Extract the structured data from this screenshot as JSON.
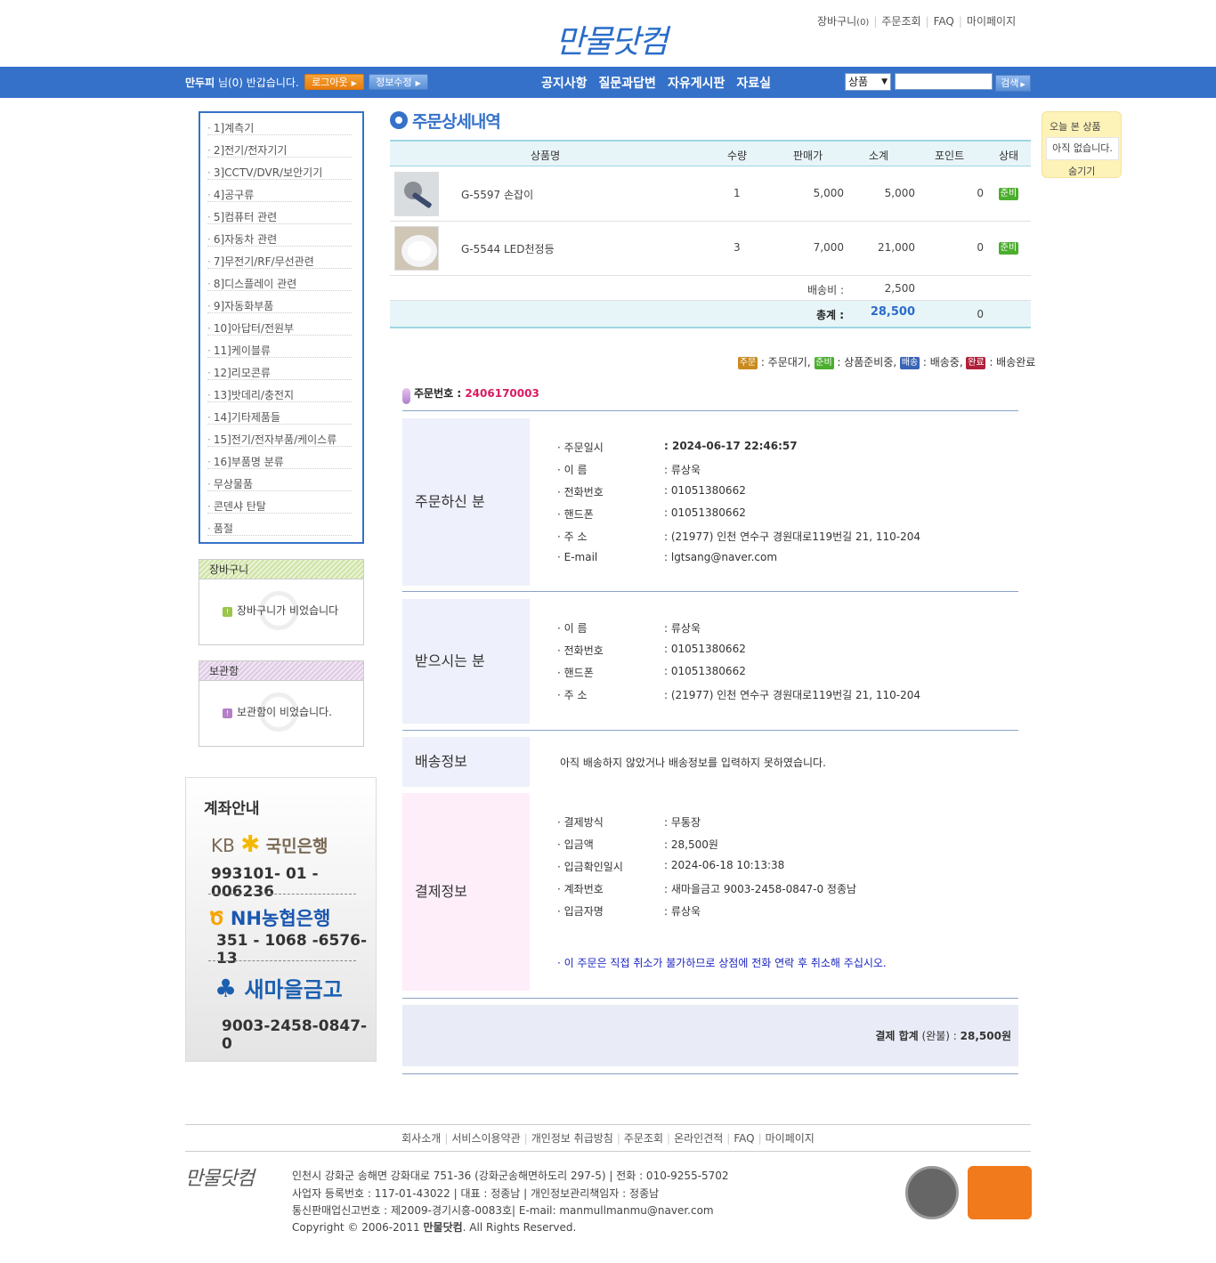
{
  "header": {
    "logo": "만물닷컴",
    "links": [
      "장바구니",
      "주문조회",
      "FAQ",
      "마이페이지"
    ],
    "cart_count": "(0)"
  },
  "navbar": {
    "user": "만두피",
    "greeting": " 님(0) 반갑습니다.",
    "logout": "로그아웃",
    "edit_info": "정보수정",
    "menu": [
      "공지사항",
      "질문과답변",
      "자유게시판",
      "자료실"
    ],
    "search_select": "상품",
    "search_value": "",
    "search_button": "검색"
  },
  "sidebar": {
    "categories": [
      "1]계측기",
      "2]전기/전자기기",
      "3]CCTV/DVR/보안기기",
      "4]공구류",
      "5]컴퓨터 관련",
      "6]자동차 관련",
      "7]무전기/RF/무선관련",
      "8]디스플레이 관련",
      "9]자동화부품",
      "10]아답터/전원부",
      "11]케이블류",
      "12]리모콘류",
      "13]밧데리/충전지",
      "14]기타제품들",
      "15]전기/전자부품/케이스류",
      "16]부품명 분류",
      "무상물품",
      "콘덴샤 탄탈",
      "품절"
    ],
    "cart_title": "장바구니",
    "cart_empty": "장바구니가 비었습니다",
    "keep_title": "보관함",
    "keep_empty": "보관함이 비었습니다.",
    "bank_title": "계좌안내",
    "banks": [
      {
        "name": "KB 국민은행",
        "account": "993101- 01 - 006236",
        "color": "#7a6a55"
      },
      {
        "name": "NH농협은행",
        "account": "351 - 1068 -6576-13",
        "color": "#1b57b0"
      },
      {
        "name": "새마을금고",
        "account": "9003-2458-0847-0",
        "color": "#1b5fb0"
      }
    ]
  },
  "today": {
    "title": "오늘 본 상품",
    "empty": "아직 없습니다.",
    "hide": "숨기기"
  },
  "main": {
    "title": "주문상세내역",
    "columns": [
      "상품명",
      "수량",
      "판매가",
      "소계",
      "포인트",
      "상태"
    ],
    "items": [
      {
        "name": "G-5597 손잡이",
        "qty": "1",
        "price": "5,000",
        "subtotal": "5,000",
        "point": "0",
        "status": "준비"
      },
      {
        "name": "G-5544 LED천정등",
        "qty": "3",
        "price": "7,000",
        "subtotal": "21,000",
        "point": "0",
        "status": "준비"
      }
    ],
    "shipping_label": "배송비 :",
    "shipping_value": "2,500",
    "total_label": "총계 :",
    "total_value": "28,500",
    "total_point": "0",
    "legend": [
      {
        "badge": "주문",
        "text": ": 주문대기,",
        "color": "#c98a1e"
      },
      {
        "badge": "준비",
        "text": ": 상품준비중,",
        "color": "#4cae2e"
      },
      {
        "badge": "배송",
        "text": ": 배송중,",
        "color": "#3a64b6"
      },
      {
        "badge": "완료",
        "text": ": 배송완료",
        "color": "#b0203a"
      }
    ],
    "order_number_label": "주문번호 :",
    "order_number": "2406170003",
    "orderer": {
      "label": "주문하신 분",
      "rows": [
        {
          "k": "· 주문일시",
          "v": ": 2024-06-17 22:46:57"
        },
        {
          "k": "· 이 름",
          "v": ": 류상욱"
        },
        {
          "k": "· 전화번호",
          "v": ": 01051380662"
        },
        {
          "k": "· 핸드폰",
          "v": ": 01051380662"
        },
        {
          "k": "· 주 소",
          "v": ": (21977) 인천 연수구 경원대로119번길 21, 110-204"
        },
        {
          "k": "· E-mail",
          "v": ": lgtsang@naver.com"
        }
      ]
    },
    "receiver": {
      "label": "받으시는 분",
      "rows": [
        {
          "k": "· 이 름",
          "v": ": 류상욱"
        },
        {
          "k": "· 전화번호",
          "v": ": 01051380662"
        },
        {
          "k": "· 핸드폰",
          "v": ": 01051380662"
        },
        {
          "k": "· 주 소",
          "v": ": (21977) 인천 연수구 경원대로119번길 21, 110-204"
        }
      ]
    },
    "delivery": {
      "label": "배송정보",
      "text": "아직 배송하지 않았거나 배송정보를 입력하지 못하였습니다."
    },
    "payment": {
      "label": "결제정보",
      "rows": [
        {
          "k": "· 결제방식",
          "v": ": 무통장"
        },
        {
          "k": "· 입금액",
          "v": ": 28,500원"
        },
        {
          "k": "· 입금확인일시",
          "v": ": 2024-06-18 10:13:38"
        },
        {
          "k": "· 계좌번호",
          "v": ": 새마을금고 9003-2458-0847-0 정종남"
        },
        {
          "k": "· 입금자명",
          "v": ": 류상욱"
        }
      ],
      "notice": "· 이 주문은 직접 취소가 불가하므로 상점에 전화 연락 후 취소해 주십시오."
    },
    "pay_total_label": "결제 합계",
    "pay_total_status": " (완불) : ",
    "pay_total_value": "28,500원"
  },
  "footer": {
    "links": [
      "회사소개",
      "서비스이용약관",
      "개인정보 취급방침",
      "주문조회",
      "온라인견적",
      "FAQ",
      "마이페이지"
    ],
    "logo": "만물닷컴",
    "lines": [
      "인천시 강화군 송해면 강화대로 751-36 (강화군송해면하도리 297-5) | 전화 : 010-9255-5702",
      "사업자 등록번호 : 117-01-43022 | 대표 : 정종남 | 개인정보관리책임자 : 정종남",
      "통신판매업신고번호 : 제2009-경기시흥-0083호| E-mail: manmullmanmu@naver.com"
    ],
    "copyright_pre": "Copyright © 2006-2011 ",
    "copyright_brand": "만물닷컴",
    "copyright_post": ". All Rights Reserved."
  }
}
